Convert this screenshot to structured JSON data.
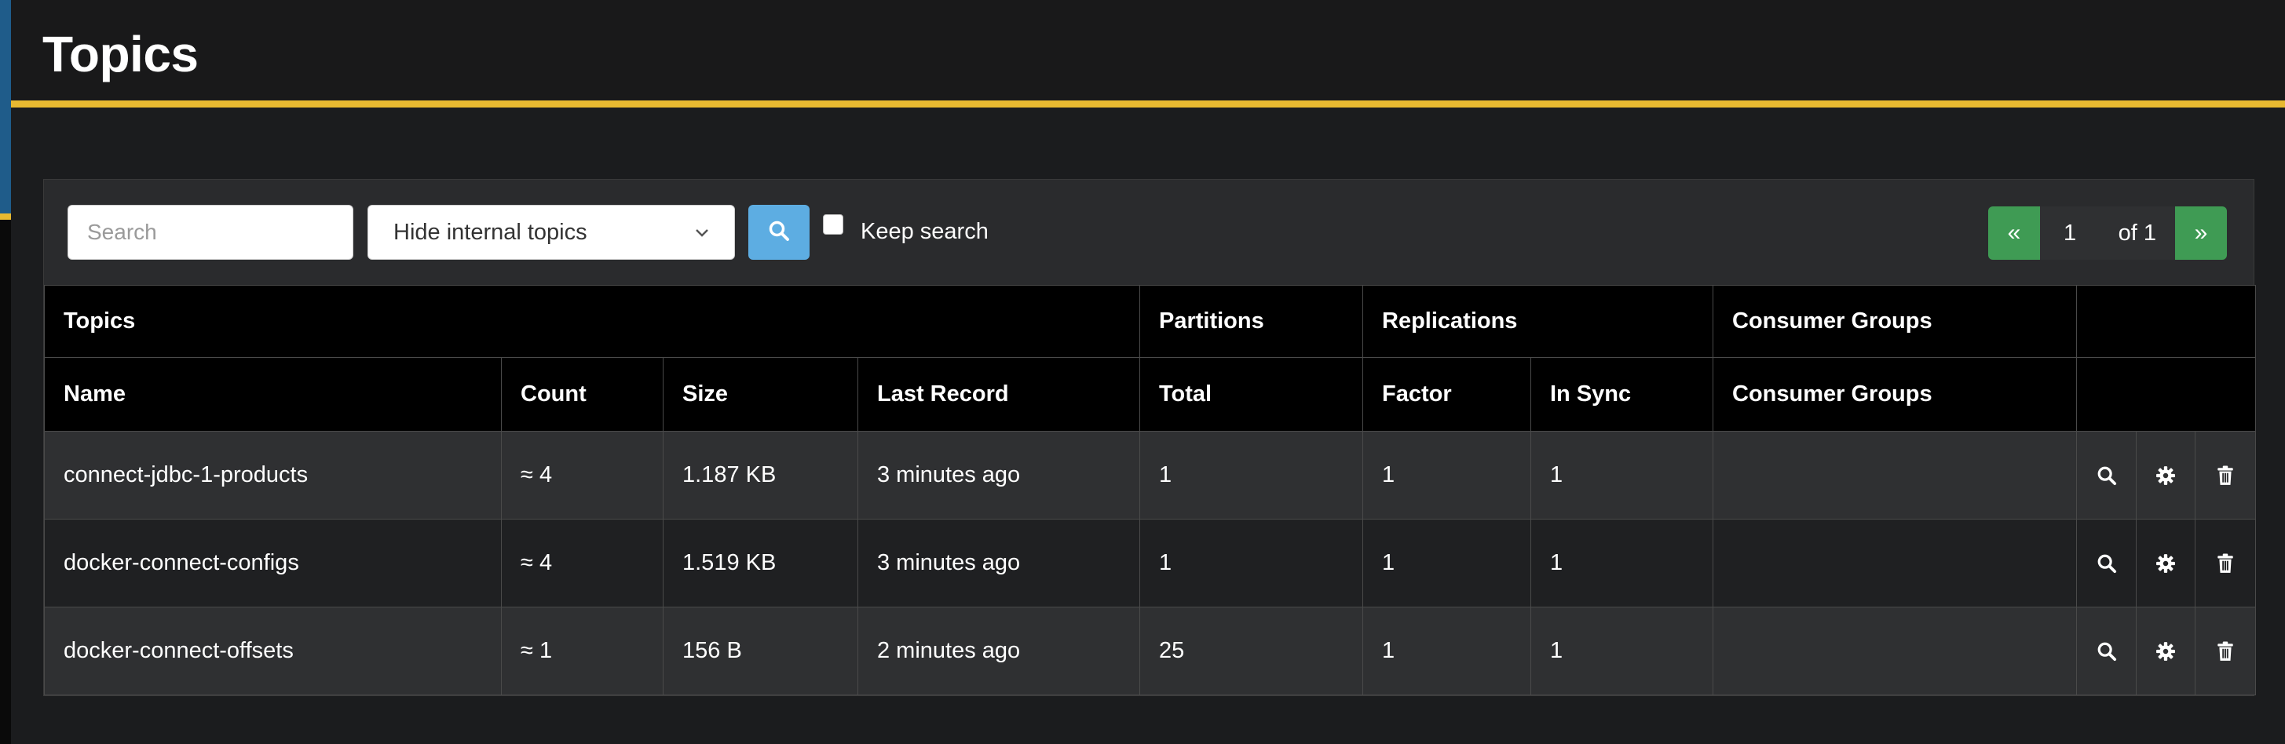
{
  "header": {
    "title": "Topics"
  },
  "toolbar": {
    "search_placeholder": "Search",
    "filter_selected": "Hide internal topics",
    "keep_search_label": "Keep search"
  },
  "pagination": {
    "first": "«",
    "current": "1",
    "of": "of 1",
    "last": "»"
  },
  "table": {
    "group_headers": {
      "topics": "Topics",
      "partitions": "Partitions",
      "replications": "Replications",
      "consumer_groups": "Consumer Groups"
    },
    "columns": {
      "name": "Name",
      "count": "Count",
      "size": "Size",
      "last_record": "Last Record",
      "total": "Total",
      "factor": "Factor",
      "in_sync": "In Sync",
      "consumer_groups": "Consumer Groups"
    },
    "rows": [
      {
        "name": "connect-jdbc-1-products",
        "count": "≈ 4",
        "size": "1.187 KB",
        "last_record": "3 minutes ago",
        "total": "1",
        "factor": "1",
        "in_sync": "1",
        "consumer_groups": ""
      },
      {
        "name": "docker-connect-configs",
        "count": "≈ 4",
        "size": "1.519 KB",
        "last_record": "3 minutes ago",
        "total": "1",
        "factor": "1",
        "in_sync": "1",
        "consumer_groups": ""
      },
      {
        "name": "docker-connect-offsets",
        "count": "≈ 1",
        "size": "156 B",
        "last_record": "2 minutes ago",
        "total": "25",
        "factor": "1",
        "in_sync": "1",
        "consumer_groups": ""
      }
    ]
  },
  "icons": {
    "search": "search-icon",
    "settings": "gear-icon",
    "delete": "trash-icon"
  },
  "colors": {
    "accent": "#e8b931",
    "search_button": "#5dade2",
    "pager": "#3f9b54"
  }
}
